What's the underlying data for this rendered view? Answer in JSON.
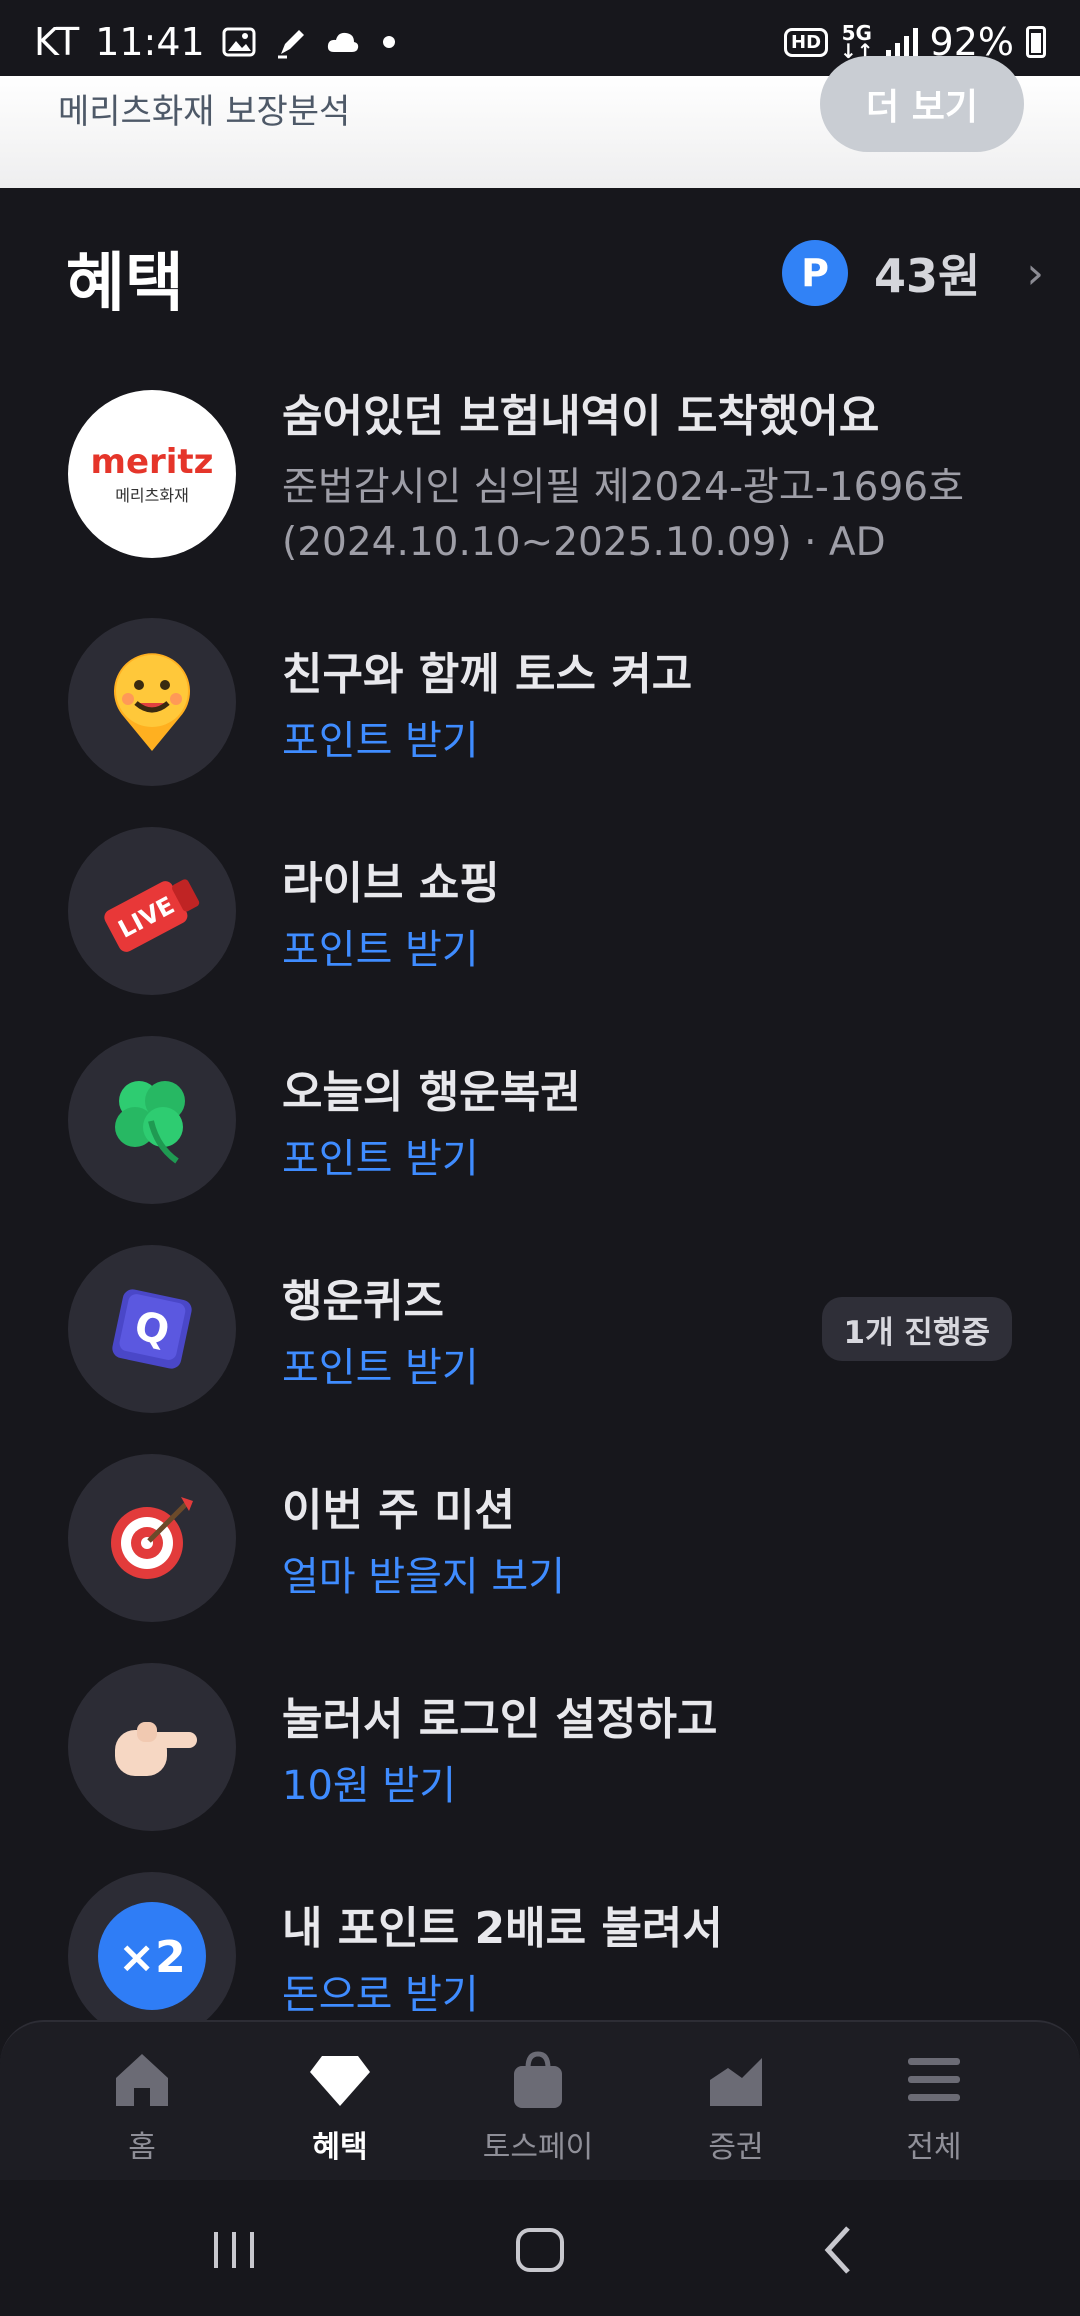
{
  "status_bar": {
    "carrier": "KT",
    "time": "11:41",
    "hd": "HD",
    "network": "5G",
    "battery": "92%"
  },
  "top_card": {
    "label": "메리츠화재 보장분석",
    "more_button": "더 보기"
  },
  "section": {
    "title": "혜택",
    "points_badge": "P",
    "points_amount": "43원"
  },
  "items": [
    {
      "logo_text": "meritz",
      "logo_sub": "메리츠화재",
      "title": "숨어있던 보험내역이 도착했어요",
      "line1": "준법감시인 심의필 제2024-광고-1696호",
      "line2": "(2024.10.10~2025.10.09) · AD"
    },
    {
      "title": "친구와 함께 토스 켜고",
      "subtitle": "포인트 받기",
      "icon": "smiley-pin-icon"
    },
    {
      "title": "라이브 쇼핑",
      "subtitle": "포인트 받기",
      "icon": "live-megaphone-icon",
      "icon_text": "LIVE"
    },
    {
      "title": "오늘의 행운복권",
      "subtitle": "포인트 받기",
      "icon": "clover-icon"
    },
    {
      "title": "행운퀴즈",
      "subtitle": "포인트 받기",
      "icon": "quiz-cube-icon",
      "icon_text": "Q",
      "chip": "1개 진행중"
    },
    {
      "title": "이번 주 미션",
      "subtitle": "얼마 받을지 보기",
      "icon": "target-icon"
    },
    {
      "title": "눌러서 로그인 설정하고",
      "subtitle": "10원 받기",
      "icon": "pointing-hand-icon"
    },
    {
      "title": "내 포인트 2배로 불려서",
      "subtitle": "돈으로 받기",
      "icon": "x2-coin-icon",
      "icon_text": "×2"
    }
  ],
  "bottom_nav": [
    {
      "label": "홈",
      "icon": "home-icon"
    },
    {
      "label": "혜택",
      "icon": "gem-icon",
      "active": true
    },
    {
      "label": "토스페이",
      "icon": "shopping-bag-icon"
    },
    {
      "label": "증권",
      "icon": "chart-icon"
    },
    {
      "label": "전체",
      "icon": "menu-icon"
    }
  ],
  "colors": {
    "background": "#17171c",
    "accent_blue": "#3182f6",
    "link_blue": "#3f8cff",
    "meritz_red": "#e5352a"
  }
}
